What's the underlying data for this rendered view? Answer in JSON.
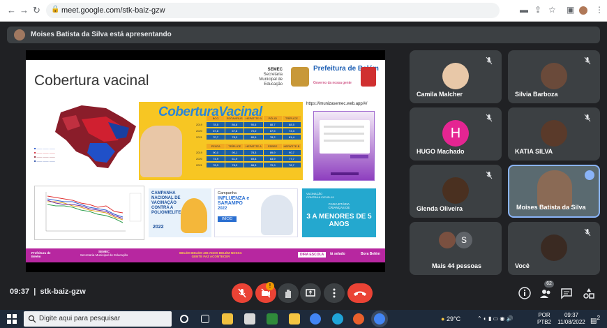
{
  "browser": {
    "url": "meet.google.com/stk-baiz-gzw"
  },
  "banner": {
    "text": "Moises Batista da Silva está apresentando"
  },
  "slide": {
    "title": "Cobertura vacinal",
    "semec": "SEMEC",
    "semec_sub": "Secretaria Municipal de Educação",
    "pref_name": "Prefeitura de Belém",
    "pref_sub": "Governo da nossa gente",
    "cv_title": "CoberturaVacinal",
    "table_headers_top": [
      "BCG",
      "ROTAVÍRUS",
      "HEPATITE B",
      "PÓLIO",
      "TRÍPLICE VIRAL"
    ],
    "table_rows_top": [
      {
        "year": "2019",
        "vals": [
          "78,5",
          "86,8",
          "90,6",
          "88,7",
          "88,5"
        ]
      },
      {
        "year": "2020",
        "vals": [
          "67,8",
          "67,8",
          "70,0",
          "67,5",
          "73,3"
        ]
      },
      {
        "year": "2021",
        "vals": [
          "70,7",
          "78,3",
          "80,9",
          "78,2",
          "81,4"
        ]
      }
    ],
    "table_headers_bottom": [
      "PENTA",
      "TRÍPLICE VIRAL",
      "HEPATITE A",
      "FEBRE AMARELA",
      "HEPATITE B"
    ],
    "table_rows_bottom": [
      {
        "year": "2019",
        "vals": [
          "90,0",
          "90,1",
          "78,3",
          "89,9",
          "90,7"
        ]
      },
      {
        "year": "2020",
        "vals": [
          "74,9",
          "61,9",
          "69,8",
          "63,9",
          "77,7"
        ]
      },
      {
        "year": "2021",
        "vals": [
          "78,3",
          "78,3",
          "88,3",
          "79,9",
          "78,7"
        ]
      }
    ],
    "url_text": "https://imunizasemec.web.app/#/",
    "campaign1": "CAMPANHA NACIONAL DE VACINAÇÃO CONTRA A POLIOMIELITE",
    "campaign1_year": "2022",
    "flu_t1": "Campanha",
    "flu_t2": "INFLUENZA e SARAMPO",
    "flu_year": "2022",
    "flu_inicio": "INÍCIO",
    "cri_t1": "VACINAÇÃO CONTRA A COVID-19",
    "cri_t2": "FAIXA ETÁRIA CRIANÇAS DE",
    "cri_big": "3 A MENORES DE 5 ANOS",
    "foot_left": "Prefeitura de Belém",
    "foot_semec": "SEMEC",
    "foot_semec_sub": "Secretaria Municipal de Educação",
    "foot_mid": "BELÉM BELÉM 406 ANOS BELÉM NOSSA GENTE FAZ ACONTECER",
    "foot_escola": "DIRA ESCOLA",
    "foot_selado": "tá selado",
    "foot_right": "Bora Belém"
  },
  "participants": [
    {
      "name": "Camila Malcher",
      "muted": true
    },
    {
      "name": "Silvia Barboza",
      "muted": true
    },
    {
      "name": "HUGO Machado",
      "muted": true,
      "initial": "H"
    },
    {
      "name": "KATIA SILVA",
      "muted": true
    },
    {
      "name": "Glenda Oliveira",
      "muted": true
    },
    {
      "name": "Moises Batista da Silva",
      "speaking": true
    },
    {
      "name": "Mais 44 pessoas",
      "initial": "S"
    },
    {
      "name": "Você",
      "muted": true
    }
  ],
  "meeting": {
    "time": "09:37",
    "code": "stk-baiz-gzw",
    "raise_badge": "!",
    "people_count": "62"
  },
  "taskbar": {
    "search": "Digite aqui para pesquisar",
    "temp": "29°C",
    "lang": "POR",
    "kb": "PTB2",
    "clock": "09:37",
    "date": "11/08/2022",
    "notif": "2"
  },
  "colors": {
    "end_call": "#ea4335",
    "accent": "#8ab4f8"
  }
}
